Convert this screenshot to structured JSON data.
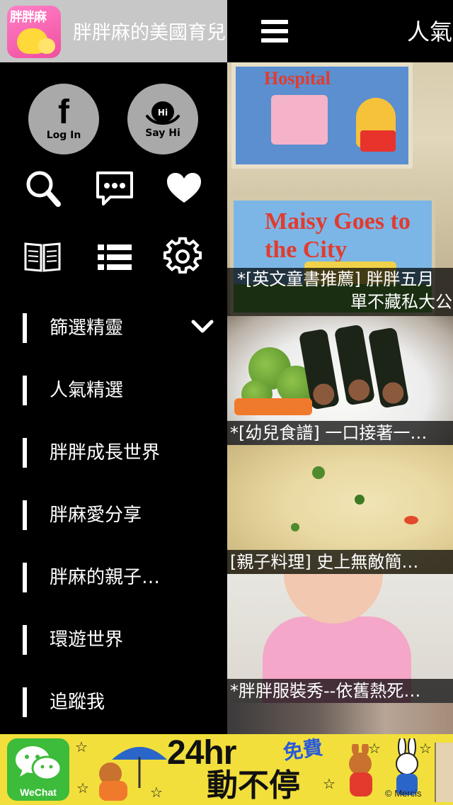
{
  "drawer": {
    "title": "胖胖麻的美國育兒",
    "app_icon_text": "胖胖麻",
    "social": {
      "login_label": "Log In",
      "sayhi_label": "Say Hi",
      "sayhi_badge": "Hi"
    },
    "nav": [
      {
        "label": "篩選精靈",
        "has_chevron": true
      },
      {
        "label": "人氣精選"
      },
      {
        "label": "胖胖成長世界"
      },
      {
        "label": "胖麻愛分享"
      },
      {
        "label": "胖麻的親子…"
      },
      {
        "label": "環遊世界"
      },
      {
        "label": "追蹤我"
      }
    ]
  },
  "main": {
    "title": "人氣",
    "cards": [
      {
        "caption_line1": "*[英文童書推薦] 胖胖五月",
        "caption_line2": "單不藏私大公"
      },
      {
        "caption": "*[幼兒食譜] 一口接著一…"
      },
      {
        "caption": "[親子料理] 史上無敵簡…"
      },
      {
        "caption": "*胖胖服裝秀--依舊熱死…"
      }
    ],
    "book_titles": {
      "book_a": "Hospital",
      "book_b_line1": "Maisy Goes to",
      "book_b_line2": "the City"
    }
  },
  "ad": {
    "wechat_label": "WeChat",
    "headline": "24hr",
    "subline": "動不停",
    "free": "免費",
    "copyright": "© Mercis"
  },
  "colors": {
    "drawer_header_bg": "#c7c7c7",
    "ad_bg": "#f2df3c",
    "wechat_green": "#3dbb3a",
    "app_icon_pink": "#f04f9e"
  }
}
